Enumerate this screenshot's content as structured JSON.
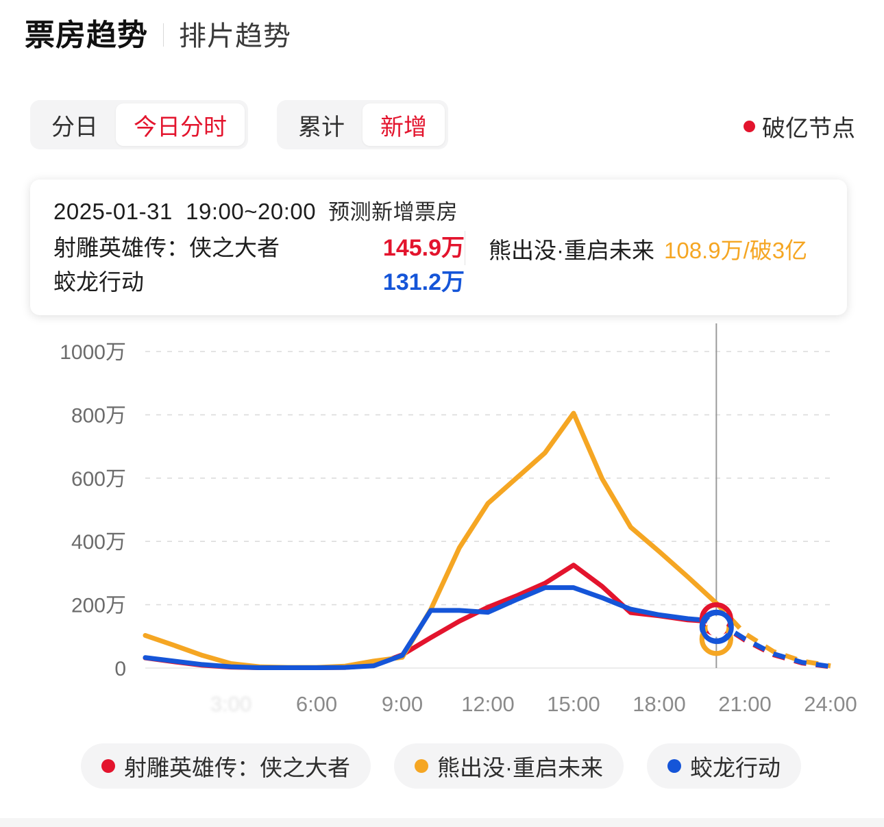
{
  "header": {
    "title_main": "票房趋势",
    "title_alt": "排片趋势",
    "separator": "|"
  },
  "controls": {
    "group1": [
      {
        "label": "分日",
        "active": false
      },
      {
        "label": "今日分时",
        "active": true
      }
    ],
    "group2": [
      {
        "label": "累计",
        "active": false
      },
      {
        "label": "新增",
        "active": true
      }
    ],
    "milestone_legend": "破亿节点",
    "milestone_color": "#E3142D"
  },
  "tooltip": {
    "date": "2025-01-31",
    "time_range": "19:00~20:00",
    "metric_label": "预测新增票房",
    "rows_left": [
      {
        "name": "射雕英雄传：侠之大者",
        "value": "145.9万",
        "color": "#E3142D"
      },
      {
        "name": "蛟龙行动",
        "value": "131.2万",
        "color": "#1555D8"
      }
    ],
    "rows_right": [
      {
        "name": "熊出没·重启未来",
        "value": "108.9万/破3亿",
        "color": "#F5A623"
      }
    ]
  },
  "legend": [
    {
      "label": "射雕英雄传：侠之大者",
      "color": "#E3142D"
    },
    {
      "label": "熊出没·重启未来",
      "color": "#F5A623"
    },
    {
      "label": "蛟龙行动",
      "color": "#1555D8"
    }
  ],
  "chart_data": {
    "type": "line",
    "title": "票房趋势 - 今日分时新增",
    "xlabel": "",
    "ylabel": "",
    "ylim": [
      0,
      1000
    ],
    "yticks": [
      0,
      200,
      400,
      600,
      800,
      1000
    ],
    "ytick_labels": [
      "0",
      "200万",
      "400万",
      "600万",
      "800万",
      "1000万"
    ],
    "grid": true,
    "legend_position": "bottom",
    "unit": "万",
    "x": [
      0,
      1,
      2,
      3,
      4,
      5,
      6,
      7,
      8,
      9,
      10,
      11,
      12,
      13,
      14,
      15,
      16,
      17,
      18,
      19,
      20,
      21,
      22,
      23,
      24
    ],
    "xtick_values": [
      3,
      6,
      9,
      12,
      15,
      18,
      21,
      24
    ],
    "xtick_labels": [
      "3:00",
      "6:00",
      "9:00",
      "12:00",
      "15:00",
      "18:00",
      "21:00",
      "24:00"
    ],
    "xtick_faded_index": 0,
    "cursor_x": 20,
    "cursor_label": "20:00",
    "forecast_start_x": 20,
    "series": [
      {
        "name": "射雕英雄传：侠之大者",
        "color": "#E3142D",
        "values": [
          32,
          20,
          9,
          3,
          1,
          1,
          1,
          2,
          8,
          42,
          96,
          148,
          192,
          228,
          268,
          325,
          258,
          175,
          165,
          152,
          146,
          88,
          42,
          16,
          4
        ],
        "forecast_from": 20
      },
      {
        "name": "熊出没·重启未来",
        "color": "#F5A623",
        "values": [
          103,
          72,
          40,
          14,
          4,
          2,
          2,
          6,
          22,
          34,
          185,
          380,
          520,
          600,
          680,
          805,
          598,
          445,
          368,
          288,
          205,
          109,
          52,
          22,
          7
        ],
        "forecast_from": 20
      },
      {
        "name": "蛟龙行动",
        "color": "#1555D8",
        "values": [
          33,
          22,
          11,
          4,
          1,
          1,
          1,
          2,
          7,
          40,
          182,
          182,
          176,
          216,
          254,
          254,
          222,
          186,
          168,
          156,
          148,
          92,
          45,
          18,
          5
        ],
        "forecast_from": 20
      }
    ],
    "hover_markers": [
      {
        "series": "射雕英雄传：侠之大者",
        "x": 20,
        "y": 145.9,
        "color": "#E3142D"
      },
      {
        "series": "蛟龙行动",
        "x": 20,
        "y": 131.2,
        "color": "#1555D8"
      },
      {
        "series": "熊出没·重启未来",
        "x": 20,
        "y": 108.9,
        "color": "#F5A623"
      }
    ]
  }
}
